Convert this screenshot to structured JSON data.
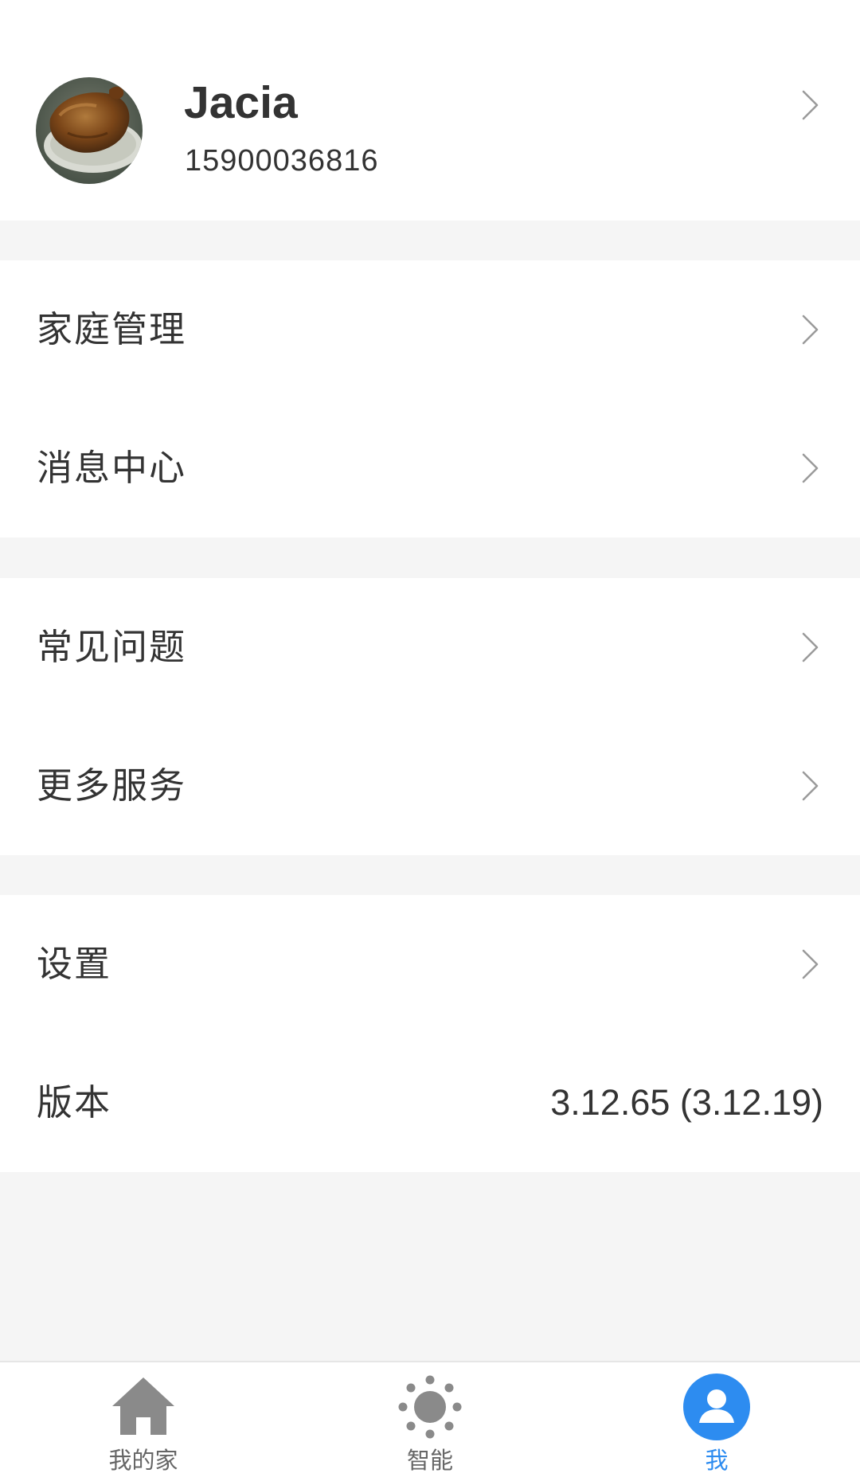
{
  "colors": {
    "accent": "#2d8cf0",
    "text": "#333333",
    "background": "#f5f5f5",
    "card": "#ffffff",
    "inactive_icon": "#8a8a8a"
  },
  "profile": {
    "name": "Jacia",
    "phone": "15900036816",
    "avatar_icon": "avatar-photo"
  },
  "menu_groups": [
    {
      "items": [
        {
          "label": "家庭管理",
          "icon": "chevron-right-icon"
        },
        {
          "label": "消息中心",
          "icon": "chevron-right-icon"
        }
      ]
    },
    {
      "items": [
        {
          "label": "常见问题",
          "icon": "chevron-right-icon"
        },
        {
          "label": "更多服务",
          "icon": "chevron-right-icon"
        }
      ]
    },
    {
      "items": [
        {
          "label": "设置",
          "icon": "chevron-right-icon"
        },
        {
          "label": "版本",
          "value": "3.12.65 (3.12.19)"
        }
      ]
    }
  ],
  "tabbar": {
    "tabs": [
      {
        "label": "我的家",
        "icon": "home-icon",
        "active": false
      },
      {
        "label": "智能",
        "icon": "sun-icon",
        "active": false
      },
      {
        "label": "我",
        "icon": "user-icon",
        "active": true
      }
    ]
  }
}
